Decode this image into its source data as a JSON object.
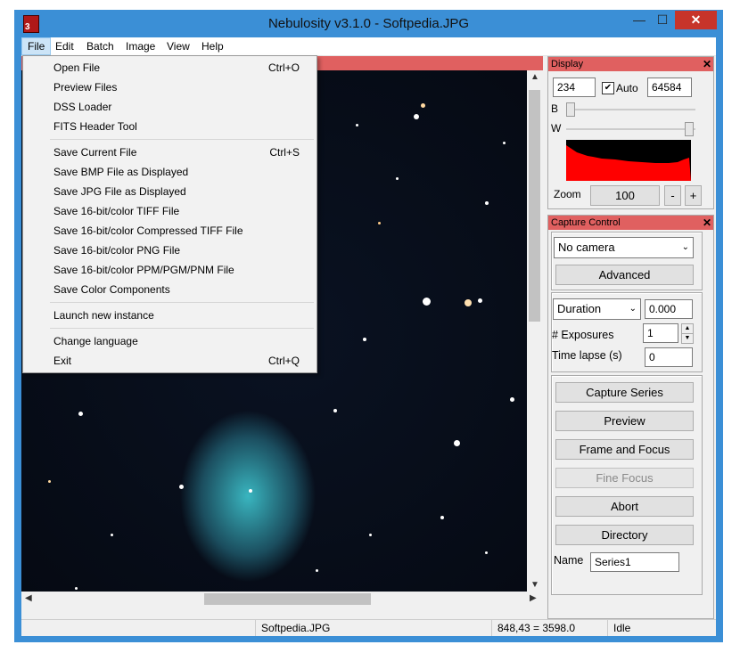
{
  "window": {
    "title": "Nebulosity v3.1.0 - Softpedia.JPG",
    "icon_label": "3"
  },
  "window_buttons": {
    "minimize": "—",
    "maximize": "☐",
    "close": "✕"
  },
  "menubar": [
    "File",
    "Edit",
    "Batch",
    "Image",
    "View",
    "Help"
  ],
  "file_menu": {
    "group1": [
      {
        "label": "Open File",
        "shortcut": "Ctrl+O"
      },
      {
        "label": "Preview Files",
        "shortcut": ""
      },
      {
        "label": "DSS Loader",
        "shortcut": ""
      },
      {
        "label": "FITS Header Tool",
        "shortcut": ""
      }
    ],
    "group2": [
      {
        "label": "Save Current File",
        "shortcut": "Ctrl+S"
      },
      {
        "label": "Save BMP File as Displayed",
        "shortcut": ""
      },
      {
        "label": "Save JPG File as Displayed",
        "shortcut": ""
      },
      {
        "label": "Save 16-bit/color TIFF File",
        "shortcut": ""
      },
      {
        "label": "Save 16-bit/color Compressed TIFF File",
        "shortcut": ""
      },
      {
        "label": "Save 16-bit/color PNG File",
        "shortcut": ""
      },
      {
        "label": "Save 16-bit/color PPM/PGM/PNM File",
        "shortcut": ""
      },
      {
        "label": "Save Color Components",
        "shortcut": ""
      }
    ],
    "group3": [
      {
        "label": "Launch new instance",
        "shortcut": ""
      }
    ],
    "group4": [
      {
        "label": "Change language",
        "shortcut": ""
      },
      {
        "label": "Exit",
        "shortcut": "Ctrl+Q"
      }
    ]
  },
  "display_panel": {
    "title": "Display",
    "close": "✕",
    "black_value": "234",
    "auto_label": "Auto",
    "auto_checked": true,
    "white_value": "64584",
    "b_label": "B",
    "w_label": "W",
    "zoom_label": "Zoom",
    "zoom_value": "100",
    "zoom_minus": "-",
    "zoom_plus": "+"
  },
  "capture_panel": {
    "title": "Capture Control",
    "close": "✕",
    "camera": "No camera",
    "advanced": "Advanced",
    "duration_select": "Duration",
    "duration_value": "0.000",
    "exposures_label": "# Exposures",
    "exposures_value": "1",
    "timelapse_label": "Time lapse (s)",
    "timelapse_value": "0",
    "buttons": [
      "Capture Series",
      "Preview",
      "Frame and Focus",
      "Fine Focus",
      "Abort",
      "Directory"
    ],
    "name_label": "Name",
    "name_value": "Series1"
  },
  "statusbar": {
    "file": "Softpedia.JPG",
    "coords": "848,43 = 3598.0",
    "state": "Idle"
  },
  "colors": {
    "titlebar": "#3b8fd6",
    "panel_header": "#e06060",
    "histogram": "#ff0000",
    "close_button": "#c7342a"
  }
}
